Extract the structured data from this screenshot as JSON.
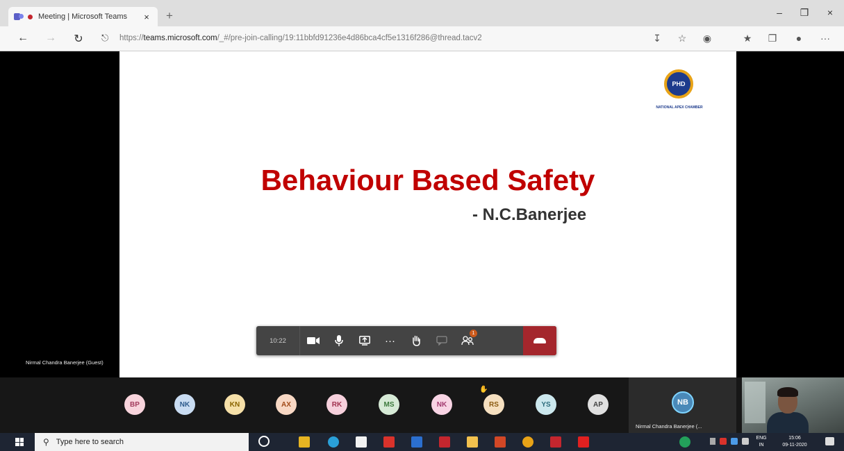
{
  "browser": {
    "tab_title": "Meeting | Microsoft Teams",
    "tab_close": "×",
    "new_tab": "+",
    "url_prefix": "https://",
    "url_host": "teams.microsoft.com",
    "url_path": "/_#/pre-join-calling/19:11bbfd91236e4d86bca4cf5e1316f286@thread.tacv2",
    "back": "←",
    "forward": "→",
    "refresh": "↻",
    "lock": "🔒",
    "minimize": "–",
    "maximize": "❐",
    "close": "×",
    "more": "···"
  },
  "slide": {
    "title": "Behaviour Based Safety",
    "author": "- N.C.Banerjee",
    "logo_text": "PHD",
    "logo_caption": "NATIONAL APEX CHAMBER"
  },
  "presenter": {
    "name": "Nirmal Chandra Banerjee (Guest)"
  },
  "controls": {
    "timer": "10:22",
    "camera": "camera-icon",
    "mic": "microphone-icon",
    "share": "share-screen-icon",
    "more": "···",
    "raise_hand": "raise-hand-icon",
    "chat": "chat-icon",
    "participants_badge": "1",
    "hangup_color": "#a4262c"
  },
  "participants": [
    {
      "initials": "BP",
      "bg": "#f8d4dc",
      "fg": "#a23b5c"
    },
    {
      "initials": "NK",
      "bg": "#c9dcf2",
      "fg": "#2c5a8c"
    },
    {
      "initials": "KN",
      "bg": "#f6e0a8",
      "fg": "#8a6400"
    },
    {
      "initials": "AX",
      "bg": "#f8d8c4",
      "fg": "#a14a17"
    },
    {
      "initials": "RK",
      "bg": "#f6d0dc",
      "fg": "#a0304e"
    },
    {
      "initials": "MS",
      "bg": "#d6ead6",
      "fg": "#3c7a3c"
    },
    {
      "initials": "NK",
      "bg": "#f8d4e4",
      "fg": "#a23b70"
    },
    {
      "initials": "RS",
      "bg": "#f6e0c0",
      "fg": "#8a5a10"
    },
    {
      "initials": "YS",
      "bg": "#cce8ee",
      "fg": "#2c6c7c"
    },
    {
      "initials": "AP",
      "bg": "#e0e0e0",
      "fg": "#444444"
    }
  ],
  "spotlight": {
    "initials": "NB",
    "name": "Nirmal Chandra Banerjee (..."
  },
  "taskbar": {
    "search_placeholder": "Type here to search",
    "lang_top": "ENG",
    "lang_bottom": "IN",
    "time": "15:06",
    "date": "09-11-2020"
  }
}
